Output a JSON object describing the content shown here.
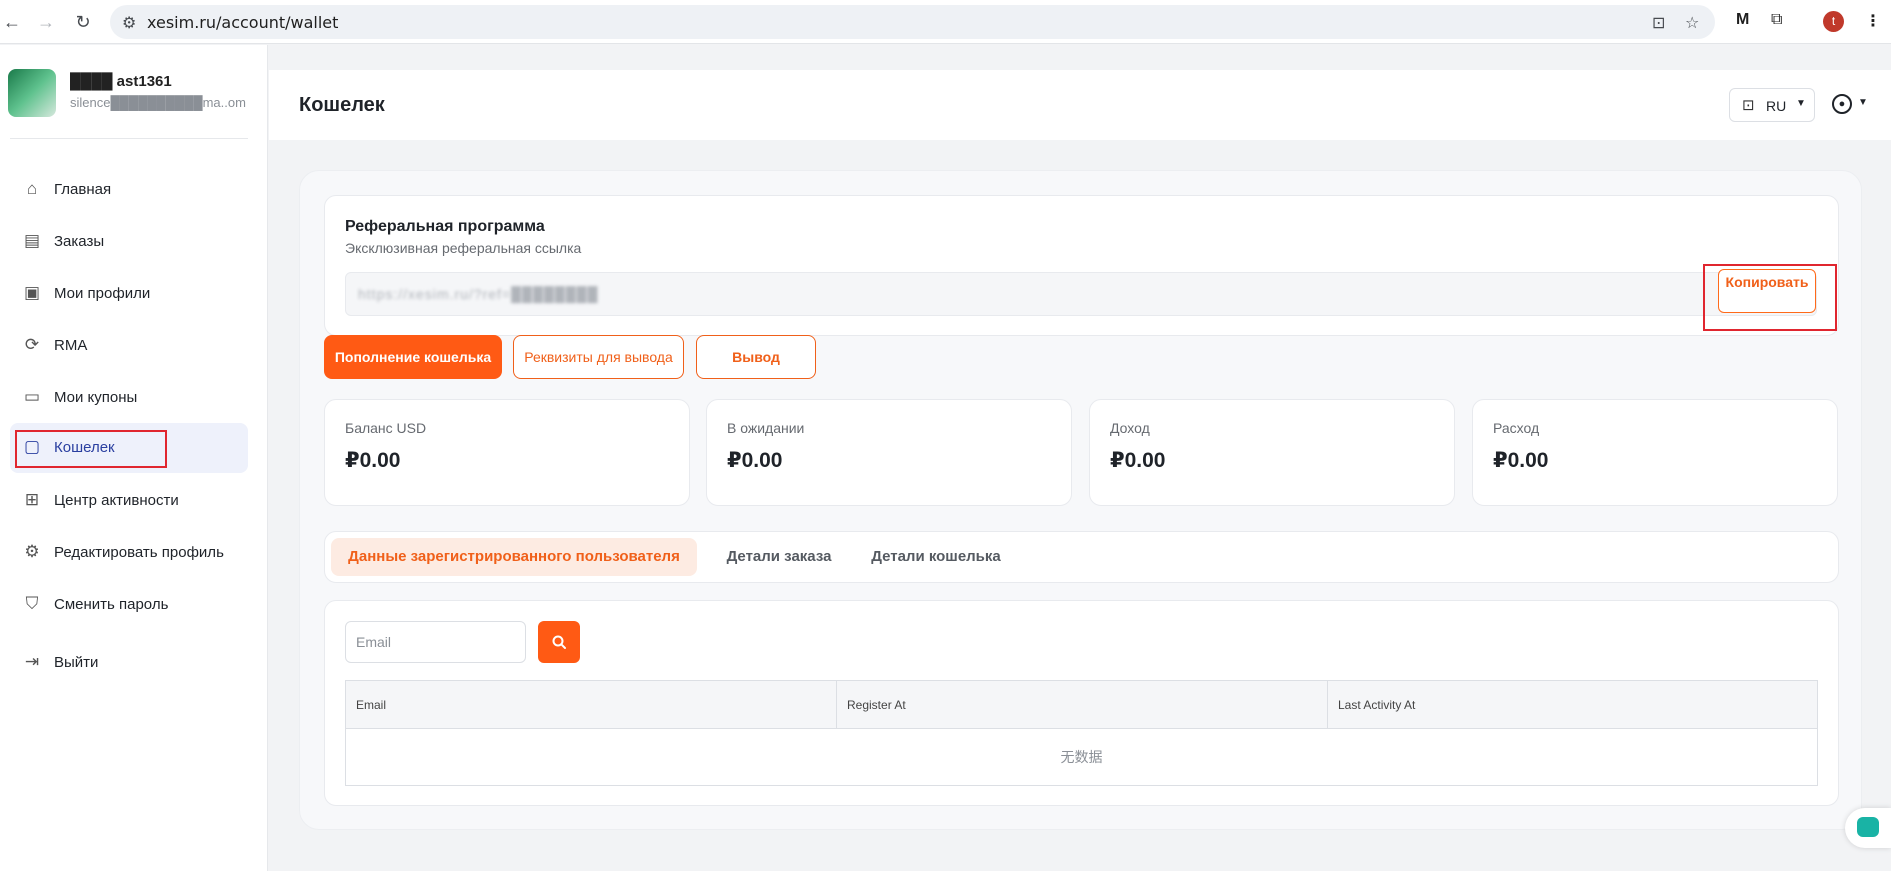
{
  "browser": {
    "url": "xesim.ru/account/wallet",
    "profile_initial": "t"
  },
  "sidebar": {
    "user_name": "████ ast1361",
    "user_email": "silence██████████ma..om",
    "items": [
      {
        "label": "Главная",
        "icon": "home-icon",
        "glyph": "⌂"
      },
      {
        "label": "Заказы",
        "icon": "orders-icon",
        "glyph": "▤"
      },
      {
        "label": "Мои профили",
        "icon": "profiles-icon",
        "glyph": "▣"
      },
      {
        "label": "RMA",
        "icon": "refresh-icon",
        "glyph": "⟳"
      },
      {
        "label": "Мои купоны",
        "icon": "coupon-icon",
        "glyph": "▭"
      },
      {
        "label": "Кошелек",
        "icon": "wallet-icon",
        "glyph": "▢"
      },
      {
        "label": "Центр активности",
        "icon": "gift-icon",
        "glyph": "⊞"
      },
      {
        "label": "Редактировать профиль",
        "icon": "gear-icon",
        "glyph": "⚙"
      },
      {
        "label": "Сменить пароль",
        "icon": "shield-icon",
        "glyph": "⛉"
      },
      {
        "label": "Выйти",
        "icon": "logout-icon",
        "glyph": "⇥"
      }
    ]
  },
  "header": {
    "title": "Кошелек",
    "lang": "RU"
  },
  "referral": {
    "title": "Реферальная программа",
    "subtitle": "Эксклюзивная реферальная ссылка",
    "link": "https://xesim.ru/?ref=████████",
    "copy_label": "Копировать"
  },
  "actions": {
    "topup": "Пополнение кошелька",
    "details": "Реквизиты для вывода",
    "withdraw": "Вывод"
  },
  "stats": [
    {
      "label": "Баланс USD",
      "value": "₽0.00"
    },
    {
      "label": "В ожидании",
      "value": "₽0.00"
    },
    {
      "label": "Доход",
      "value": "₽0.00"
    },
    {
      "label": "Расход",
      "value": "₽0.00"
    }
  ],
  "tabs": [
    {
      "label": "Данные зарегистрированного пользователя",
      "active": true
    },
    {
      "label": "Детали заказа",
      "active": false
    },
    {
      "label": "Детали кошелька",
      "active": false
    }
  ],
  "table": {
    "search_placeholder": "Email",
    "columns": [
      "Email",
      "Register At",
      "Last Activity At"
    ],
    "empty_text": "无数据"
  },
  "colors": {
    "accent": "#ff5a14",
    "highlight": "#e0262f",
    "active_nav": "#2a3fa0"
  }
}
